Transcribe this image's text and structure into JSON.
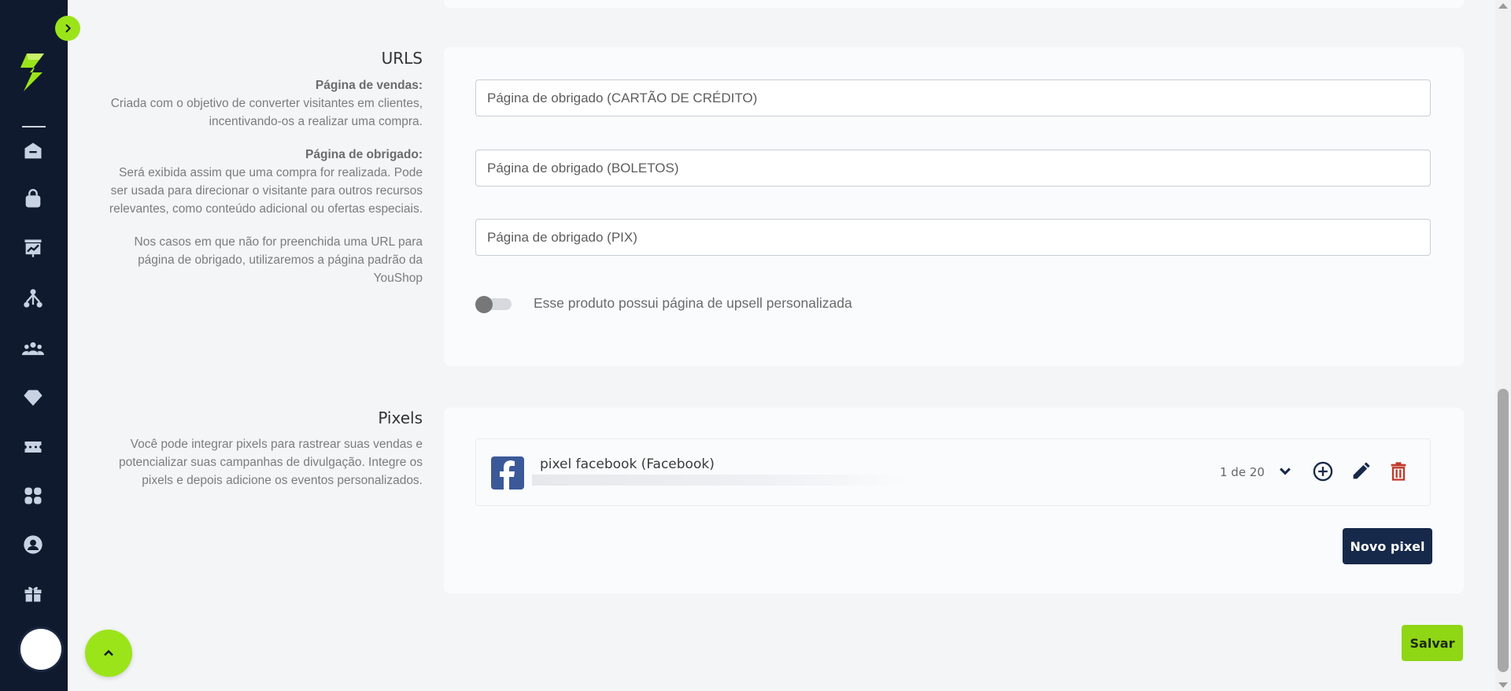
{
  "colors": {
    "sidebar_bg": "#0f1a2e",
    "accent_green": "#9be41a",
    "primary_navy": "#17294a",
    "delete_red": "#c0392b",
    "facebook_blue": "#3b5998"
  },
  "sidebar": {
    "toggle_icon": "chevron-right-icon",
    "logo_icon": "youshop-logo-icon",
    "items": [
      {
        "icon": "home-icon"
      },
      {
        "icon": "shopping-bag-icon"
      },
      {
        "icon": "dashboard-chart-icon"
      },
      {
        "icon": "affiliate-network-icon"
      },
      {
        "icon": "users-group-icon"
      },
      {
        "icon": "diamond-icon"
      },
      {
        "icon": "ticket-icon"
      },
      {
        "icon": "apps-grid-icon"
      },
      {
        "icon": "user-circle-icon"
      },
      {
        "icon": "gift-icon"
      }
    ]
  },
  "urls": {
    "title": "URLS",
    "sales_heading": "Página de vendas:",
    "sales_text": "Criada com o objetivo de converter visitantes em clientes, incentivando-os a realizar uma compra.",
    "thanks_heading": "Página de obrigado:",
    "thanks_text": "Será exibida assim que uma compra for realizada. Pode ser usada para direcionar o visitante para outros recursos relevantes, como conteúdo adicional ou ofertas especiais.",
    "default_text": "Nos casos em que não for preenchida uma URL para página de obrigado, utilizaremos a página padrão da YouShop",
    "inputs": {
      "credit_card": {
        "placeholder": "Página de obrigado (CARTÃO DE CRÉDITO)",
        "value": ""
      },
      "boletos": {
        "placeholder": "Página de obrigado (BOLETOS)",
        "value": ""
      },
      "pix": {
        "placeholder": "Página de obrigado (PIX)",
        "value": ""
      }
    },
    "upsell_toggle": {
      "label": "Esse produto possui página de upsell personalizada",
      "on": false
    }
  },
  "pixels": {
    "title": "Pixels",
    "description": "Você pode integrar pixels para rastrear suas vendas e potencializar suas campanhas de divulgação. Integre os pixels e depois adicione os eventos personalizados.",
    "items": [
      {
        "name": "pixel facebook (Facebook)",
        "icon": "facebook-icon",
        "count_label": "1 de 20"
      }
    ],
    "new_button": "Novo pixel"
  },
  "save_button": "Salvar",
  "scroll_top_icon": "chevron-up-icon"
}
